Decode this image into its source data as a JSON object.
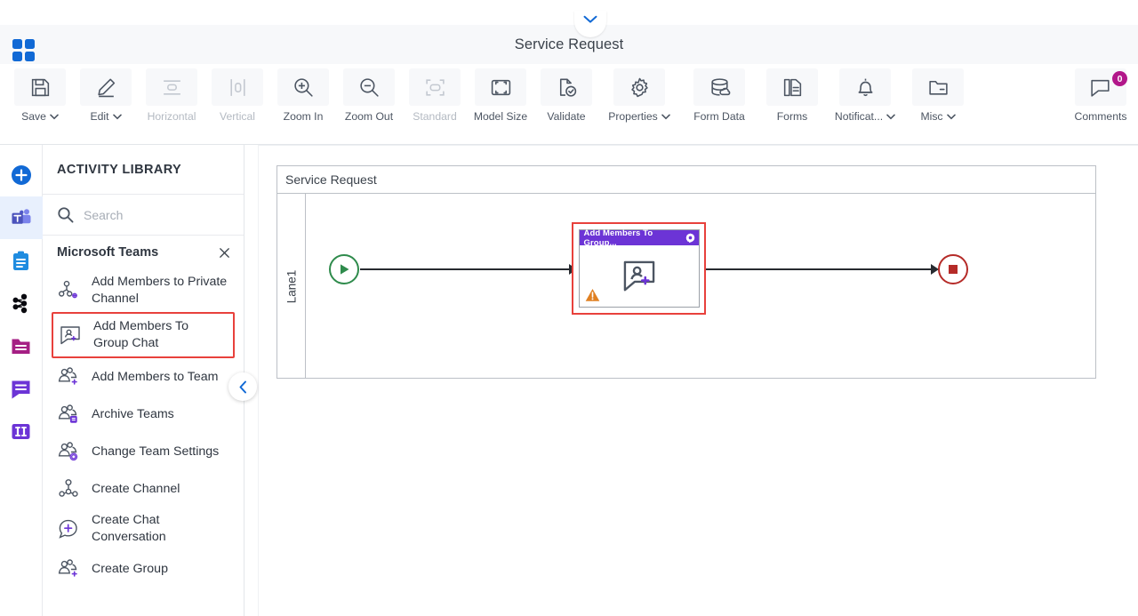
{
  "header": {
    "title": "Service Request",
    "collapse_icon": "chevron-down-icon",
    "logo_icon": "app-grid-icon"
  },
  "toolbar": {
    "items": [
      {
        "label": "Save",
        "icon": "save-floppy-icon",
        "caret": true,
        "disabled": false
      },
      {
        "label": "Edit",
        "icon": "pencil-icon",
        "caret": true,
        "disabled": false
      },
      {
        "label": "Horizontal",
        "icon": "horizontal-icon",
        "caret": false,
        "disabled": true
      },
      {
        "label": "Vertical",
        "icon": "vertical-icon",
        "caret": false,
        "disabled": true
      },
      {
        "label": "Zoom In",
        "icon": "zoom-in-icon",
        "caret": false,
        "disabled": false
      },
      {
        "label": "Zoom Out",
        "icon": "zoom-out-icon",
        "caret": false,
        "disabled": false
      },
      {
        "label": "Standard",
        "icon": "standard-fit-icon",
        "caret": false,
        "disabled": true
      },
      {
        "label": "Model Size",
        "icon": "model-size-icon",
        "caret": false,
        "disabled": false
      },
      {
        "label": "Validate",
        "icon": "validate-icon",
        "caret": false,
        "disabled": false
      },
      {
        "label": "Properties",
        "icon": "gear-icon",
        "caret": true,
        "disabled": false
      },
      {
        "label": "Form Data",
        "icon": "database-icon",
        "caret": false,
        "disabled": false
      },
      {
        "label": "Forms",
        "icon": "forms-copy-icon",
        "caret": false,
        "disabled": false
      },
      {
        "label": "Notificat...",
        "icon": "bell-icon",
        "caret": true,
        "disabled": false
      },
      {
        "label": "Misc",
        "icon": "folder-icon",
        "caret": true,
        "disabled": false
      }
    ],
    "comments": {
      "label": "Comments",
      "icon": "comment-bubble-icon",
      "badge_count": "0",
      "badge_color": "#b2178a"
    }
  },
  "rail": {
    "items": [
      {
        "name": "add-new",
        "icon": "plus-circle-icon",
        "active": false
      },
      {
        "name": "microsoft-teams",
        "icon": "teams-icon",
        "active": true
      },
      {
        "name": "tasks",
        "icon": "clipboard-icon",
        "active": false
      },
      {
        "name": "workflow",
        "icon": "workflow-nodes-icon",
        "active": false
      },
      {
        "name": "folders",
        "icon": "folder-magenta-icon",
        "active": false
      },
      {
        "name": "messages",
        "icon": "chat-purple-icon",
        "active": false
      },
      {
        "name": "columns",
        "icon": "columns-icon",
        "active": false
      }
    ]
  },
  "panel": {
    "title": "ACTIVITY LIBRARY",
    "search": {
      "placeholder": "Search",
      "value": "",
      "icon": "search-icon"
    },
    "group": {
      "label": "Microsoft Teams",
      "close_icon": "close-icon"
    },
    "collapse_icon": "chevron-left-icon",
    "activities": [
      {
        "label": "Add Members to Private Channel",
        "icon": "add-member-channel-icon",
        "selected": false
      },
      {
        "label": "Add Members To Group Chat",
        "icon": "add-member-chat-icon",
        "selected": true
      },
      {
        "label": "Add Members to Team",
        "icon": "add-member-team-icon",
        "selected": false
      },
      {
        "label": "Archive Teams",
        "icon": "archive-teams-icon",
        "selected": false
      },
      {
        "label": "Change Team Settings",
        "icon": "team-settings-icon",
        "selected": false
      },
      {
        "label": "Create Channel",
        "icon": "create-channel-icon",
        "selected": false
      },
      {
        "label": "Create Chat Conversation",
        "icon": "create-chat-icon",
        "selected": false
      },
      {
        "label": "Create Group",
        "icon": "create-group-icon",
        "selected": false
      }
    ]
  },
  "canvas": {
    "pool_title": "Service Request",
    "lane_label": "Lane1",
    "start_node": {
      "name": "start-event",
      "color": "#2f8b4c"
    },
    "end_node": {
      "name": "end-event",
      "color": "#b52b28"
    },
    "task": {
      "title": "Add Members To Group...",
      "header_color": "#6c34d6",
      "selection_color": "#e8413c",
      "gear_icon": "gear-icon",
      "body_icon": "add-member-chat-icon",
      "warning_icon": "warning-triangle-icon",
      "warning_color": "#e08022"
    }
  }
}
